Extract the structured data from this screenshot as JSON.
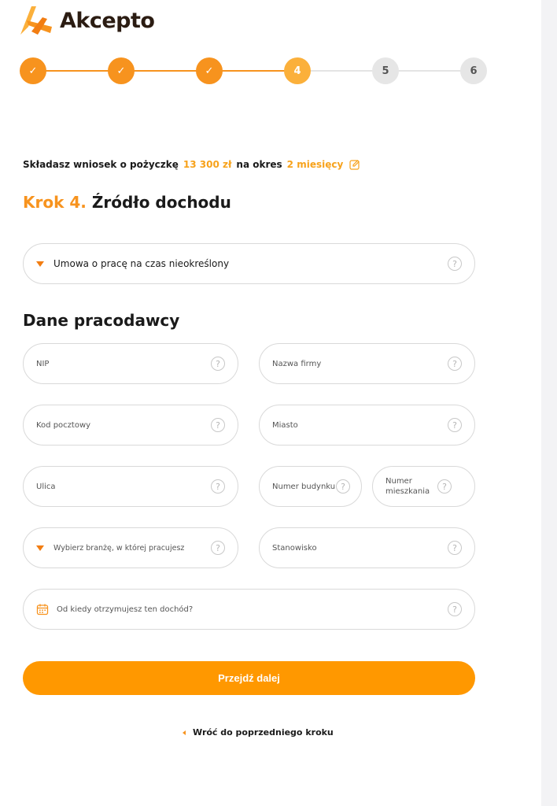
{
  "brand": {
    "name": "Akcepto",
    "accent": "#f7931e"
  },
  "stepper": {
    "steps": [
      {
        "label": "✓",
        "state": "done"
      },
      {
        "label": "✓",
        "state": "done"
      },
      {
        "label": "✓",
        "state": "done"
      },
      {
        "label": "4",
        "state": "current"
      },
      {
        "label": "5",
        "state": "todo"
      },
      {
        "label": "6",
        "state": "todo"
      }
    ]
  },
  "summary": {
    "prefix": "Składasz wniosek o pożyczkę",
    "amount": "13 300 zł",
    "middle": "na okres",
    "period": "2 miesięcy",
    "edit_icon": "edit-icon"
  },
  "step_title": {
    "number": "Krok 4.",
    "text": "Źródło dochodu"
  },
  "income_source": {
    "value": "Umowa o pracę na czas nieokreślony"
  },
  "employer_section": {
    "title": "Dane pracodawcy"
  },
  "fields": {
    "nip": "NIP",
    "company_name": "Nazwa firmy",
    "postal_code": "Kod pocztowy",
    "city": "Miasto",
    "street": "Ulica",
    "building_number": "Numer budynku",
    "apartment_number": "Numer mieszkania",
    "industry": "Wybierz branżę, w której pracujesz",
    "position": "Stanowisko",
    "income_since": "Od kiedy otrzymujesz ten dochód?"
  },
  "help_symbol": "?",
  "submit_label": "Przejdź dalej",
  "back_label": "Wróć do poprzedniego kroku"
}
